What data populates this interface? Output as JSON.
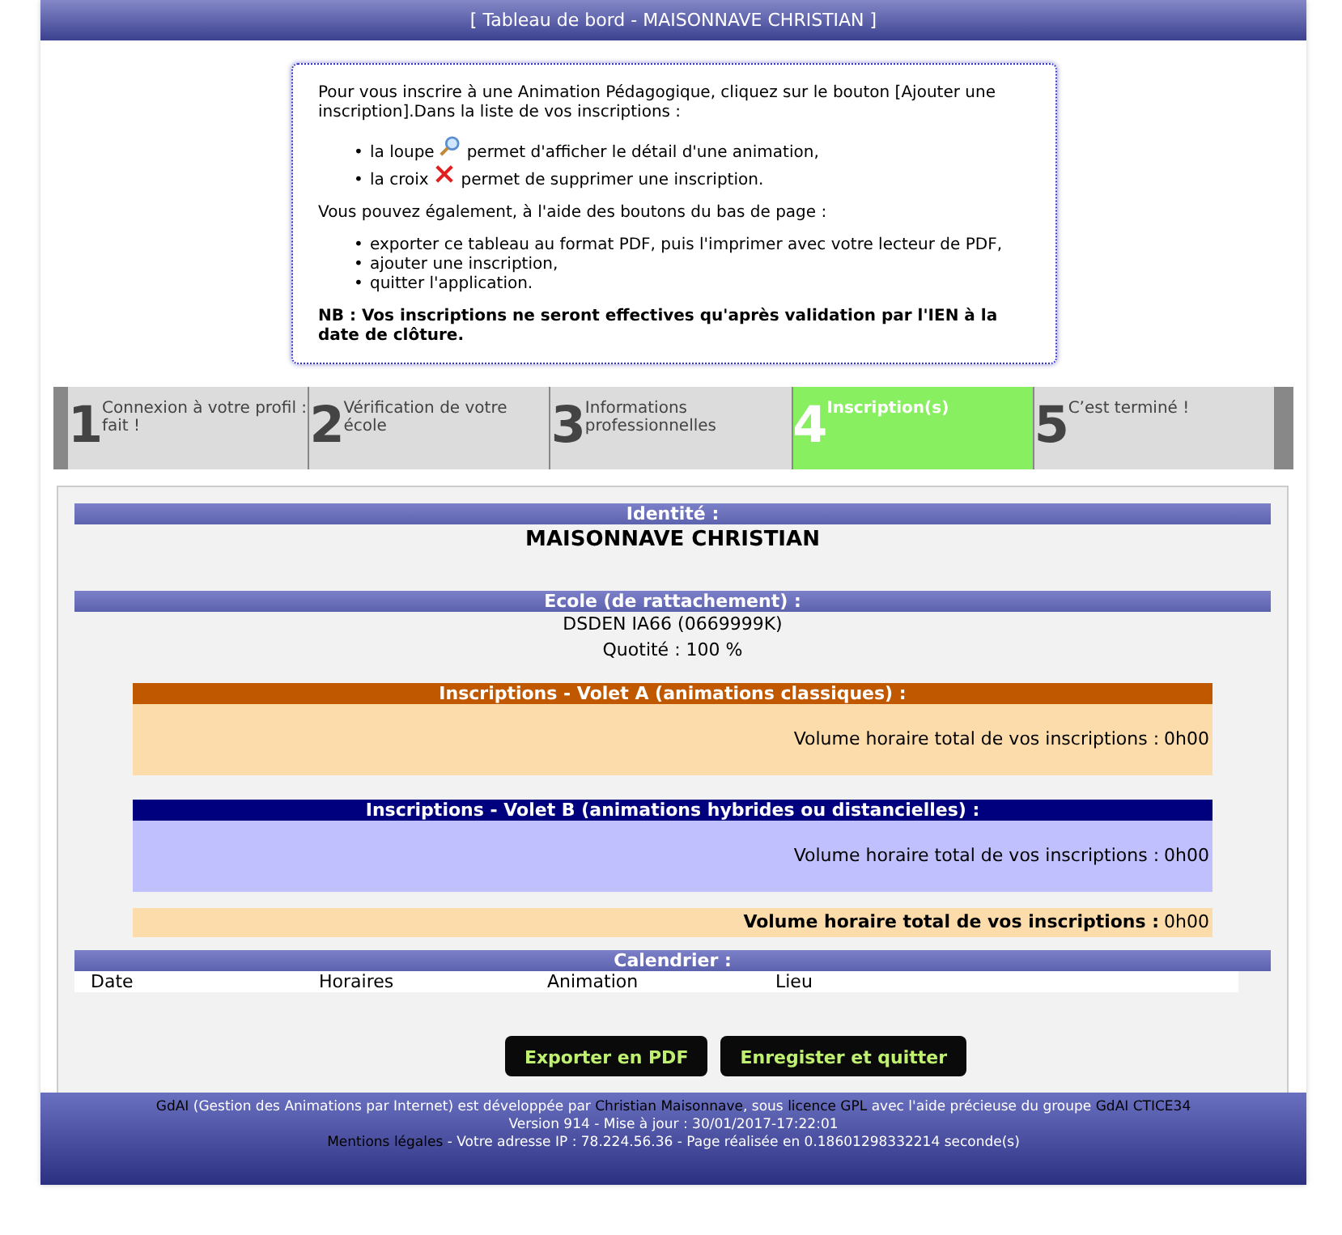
{
  "header": {
    "title": "[ Tableau de bord - MAISONNAVE CHRISTIAN ]"
  },
  "info": {
    "intro": "Pour vous inscrire à une Animation Pédagogique, cliquez sur le bouton [Ajouter une inscription].Dans la liste de vos inscriptions :",
    "icon_items": [
      {
        "marker": "•",
        "before": "la loupe",
        "after": "permet d'afficher le détail d'une animation,"
      },
      {
        "marker": "•",
        "before": "la croix",
        "after": "permet de supprimer une inscription."
      }
    ],
    "buttons_intro": "Vous pouvez également, à l'aide des boutons du bas de page :",
    "actions": [
      {
        "marker": "•",
        "text": "exporter ce tableau au format PDF, puis l'imprimer avec votre lecteur de PDF,"
      },
      {
        "marker": "•",
        "text": "ajouter une inscription,"
      },
      {
        "marker": "•",
        "text": "quitter l'application."
      }
    ],
    "note": "NB : Vos inscriptions ne seront effectives qu'après validation par l'IEN à la date de clôture."
  },
  "steps": [
    {
      "number": "1",
      "label": "Connexion à votre profil : fait !",
      "selected": false
    },
    {
      "number": "2",
      "label": "Vérification de votre école",
      "selected": false
    },
    {
      "number": "3",
      "label": "Informations professionnelles",
      "selected": false
    },
    {
      "number": "4",
      "label": "Inscription(s)",
      "selected": true
    },
    {
      "number": "5",
      "label": "C’est terminé  !",
      "selected": false
    }
  ],
  "identity": {
    "heading": "Identité :",
    "name": "MAISONNAVE CHRISTIAN"
  },
  "school": {
    "heading": "Ecole (de rattachement) :",
    "name": "DSDEN IA66 (0669999K)",
    "quotite": "Quotité :  100 %"
  },
  "volets": [
    {
      "kind": "a",
      "heading": "Inscriptions - Volet A (animations classiques) :",
      "total_label": "Volume horaire total de vos inscriptions :",
      "total": "0h00"
    },
    {
      "kind": "b",
      "heading": "Inscriptions - Volet B (animations hybrides ou distancielles) :",
      "total_label": "Volume horaire total de vos inscriptions :",
      "total": "0h00"
    },
    {
      "kind": "total",
      "total_label": "Volume horaire total de vos inscriptions :",
      "total": "0h00"
    }
  ],
  "calendar": {
    "heading": "Calendrier :",
    "columns": [
      "Date",
      "Horaires",
      "Animation",
      "Lieu"
    ]
  },
  "buttons": [
    "Exporter en PDF",
    "Enregister et quitter"
  ],
  "footer": [
    [
      {
        "text": "GdAI",
        "link": true
      },
      {
        "text": " (Gestion des Animations par Internet) est développée par ",
        "link": false
      },
      {
        "text": "Christian Maisonnave",
        "link": true
      },
      {
        "text": ", sous ",
        "link": false
      },
      {
        "text": "licence GPL",
        "link": true
      },
      {
        "text": " avec l'aide précieuse du groupe ",
        "link": false
      },
      {
        "text": "GdAI CTICE34",
        "link": true
      }
    ],
    [
      {
        "text": "Version 914 - Mise à jour : 30/01/2017-17:22:01",
        "link": false
      }
    ],
    [
      {
        "text": "Mentions légales",
        "link": true
      },
      {
        "text": " - Votre adresse IP : 78.224.56.36 - Page réalisée en 0.18601298332214 seconde(s)",
        "link": false
      }
    ]
  ]
}
